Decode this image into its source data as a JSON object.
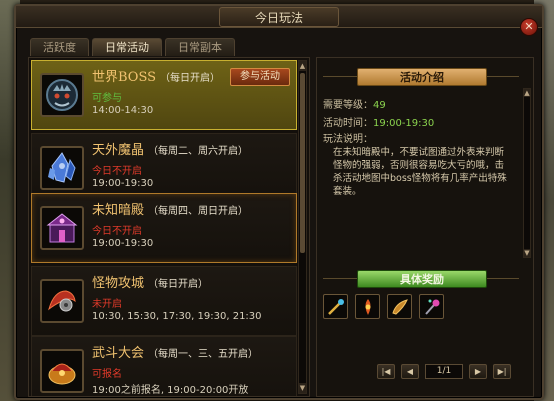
{
  "window": {
    "title": "今日玩法",
    "close_label": "✕"
  },
  "tabs": [
    {
      "label": "活跃度"
    },
    {
      "label": "日常活动"
    },
    {
      "label": "日常副本"
    }
  ],
  "events": [
    {
      "name": "世界BOSS",
      "schedule": "（每日开启）",
      "status": "可参与",
      "time": "14:00-14:30",
      "button": "参与活动",
      "icon": "boss-icon"
    },
    {
      "name": "天外魔晶",
      "schedule": "（每周二、周六开启）",
      "status": "今日不开启",
      "time": "19:00-19:30",
      "icon": "crystal-icon"
    },
    {
      "name": "未知暗殿",
      "schedule": "（每周四、周日开启）",
      "status": "今日不开启",
      "time": "19:00-19:30",
      "icon": "dark-palace-icon"
    },
    {
      "name": "怪物攻城",
      "schedule": "（每日开启）",
      "status": "未开启",
      "time": "10:30, 15:30, 17:30, 19:30, 21:30",
      "icon": "siege-icon"
    },
    {
      "name": "武斗大会",
      "schedule": "（每周一、三、五开启）",
      "status": "可报名",
      "time": "19:00之前报名, 19:00-20:00开放",
      "icon": "arena-icon"
    }
  ],
  "detail": {
    "intro_banner": "活动介绍",
    "level_label": "需要等级：",
    "level_value": "49",
    "time_label": "活动时间：",
    "time_value": "19:00-19:30",
    "desc_label": "玩法说明：",
    "description": "在未知暗殿中，不要试图通过外表来判断怪物的强弱，否则很容易吃大亏的哦，击杀活动地图中boss怪物将有几率产出特殊套装。",
    "reward_banner": "具体奖励",
    "rewards": [
      {
        "icon": "rune-staff-icon"
      },
      {
        "icon": "fire-totem-icon"
      },
      {
        "icon": "horn-icon"
      },
      {
        "icon": "gem-wand-icon"
      }
    ],
    "pager": {
      "first": "|◀",
      "prev": "◀",
      "page": "1/1",
      "next": "▶",
      "last": "▶|"
    }
  },
  "colors": {
    "gold_title": "#f0c270",
    "status_ok": "#60c040",
    "status_no": "#e03a2a",
    "selected_bg": "#6e6216"
  }
}
